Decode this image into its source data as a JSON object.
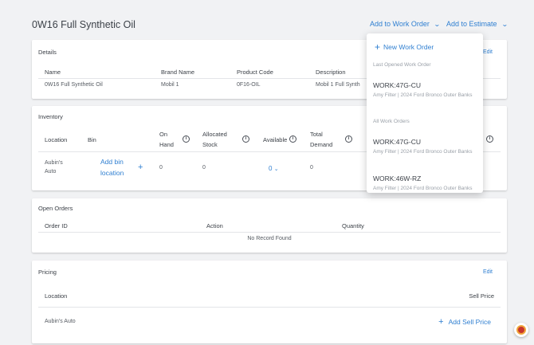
{
  "page": {
    "title": "0W16 Full Synthetic Oil"
  },
  "header_actions": {
    "add_to_work_order": "Add to Work Order",
    "add_to_estimate": "Add to Estimate"
  },
  "details": {
    "title": "Details",
    "edit": "Edit",
    "columns": [
      "Name",
      "Brand Name",
      "Product Code",
      "Description"
    ],
    "row": [
      "0W16 Full Synthetic Oil",
      "Mobil 1",
      "0F16-OIL",
      "Mobil 1 Full Synth"
    ]
  },
  "inventory": {
    "title": "Inventory",
    "columns": {
      "location": "Location",
      "bin": "Bin",
      "on_hand_1": "On",
      "on_hand_2": "Hand",
      "allocated_1": "Allocated",
      "allocated_2": "Stock",
      "available": "Available",
      "total_1": "Total",
      "total_2": "Demand"
    },
    "row": {
      "location_1": "Aubin's",
      "location_2": "Auto",
      "bin_1": "Add bin",
      "bin_2": "location",
      "bin_plus": "+",
      "on_hand": "0",
      "allocated": "0",
      "available": "0",
      "total": "0"
    }
  },
  "open_orders": {
    "title": "Open Orders",
    "columns": [
      "Order ID",
      "Action",
      "Quantity"
    ],
    "empty": "No Record Found"
  },
  "pricing": {
    "title": "Pricing",
    "edit": "Edit",
    "columns": {
      "location": "Location",
      "sell_price": "Sell Price"
    },
    "row": {
      "location": "Aubin's Auto",
      "add_sell_price": "Add Sell Price"
    }
  },
  "dropdown": {
    "new_work_order": "New Work Order",
    "last_opened_label": "Last Opened Work Order",
    "all_label": "All Work Orders",
    "last_opened": {
      "id": "WORK:47G-CU",
      "desc": "Amy Filter | 2024 Ford Bronco Outer Banks"
    },
    "all": [
      {
        "id": "WORK:47G-CU",
        "desc": "Amy Filter | 2024 Ford Bronco Outer Banks"
      },
      {
        "id": "WORK:46W-RZ",
        "desc": "Amy Filter | 2024 Ford Bronco Outer Banks"
      }
    ]
  },
  "colors": {
    "accent": "#2f7fd1",
    "background": "#f1f2f4",
    "card": "#ffffff"
  }
}
